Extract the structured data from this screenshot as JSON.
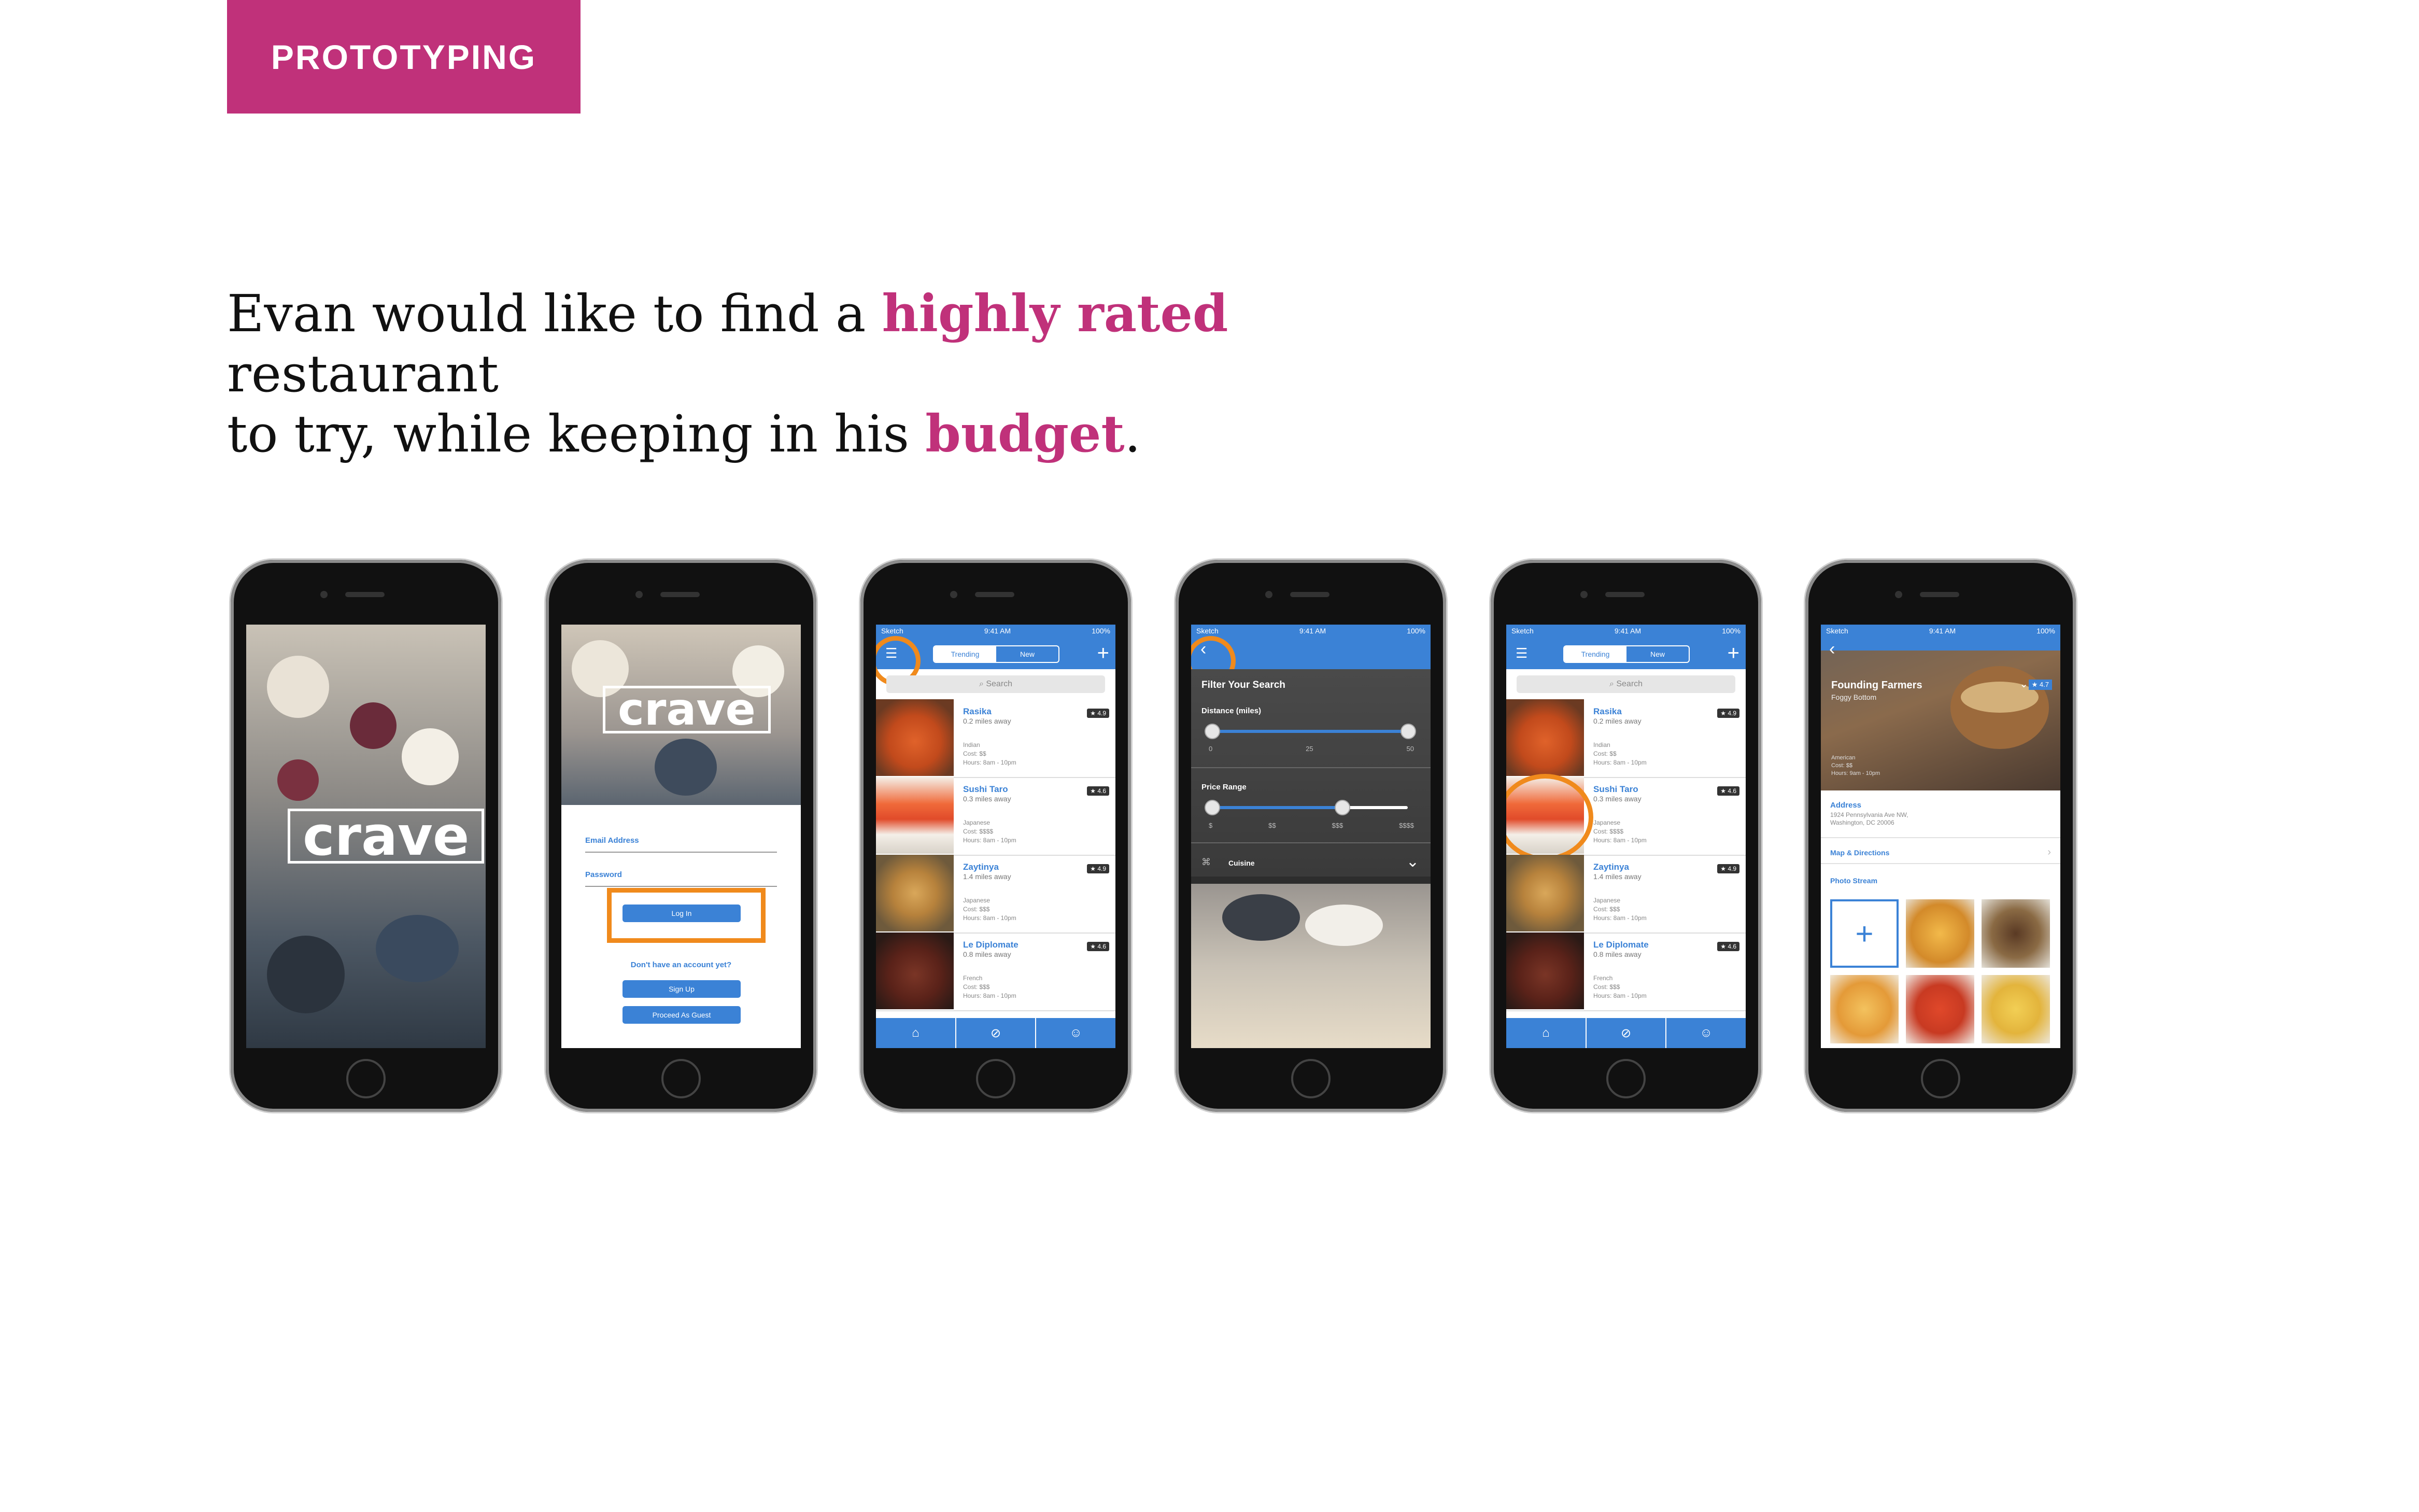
{
  "section_tag": "PROTOTYPING",
  "headline": {
    "part1": "Evan would like to find a ",
    "highlight1": "highly rated",
    "part2": " restaurant",
    "part3": "to try, while keeping in his ",
    "highlight2": "budget",
    "part4": "."
  },
  "colors": {
    "accent": "#c0317a",
    "app_blue": "#3b82d6",
    "highlight_ring": "#f08a1c"
  },
  "app": {
    "logo": "crave",
    "status": {
      "carrier": "Sketch",
      "time": "9:41 AM",
      "battery": "100%"
    },
    "login": {
      "email_label": "Email Address",
      "password_label": "Password",
      "login_button": "Log In",
      "no_account": "Don't have an account yet?",
      "signup_button": "Sign Up",
      "guest_button": "Proceed As Guest"
    },
    "tabs": {
      "trending": "Trending",
      "new": "New"
    },
    "search_placeholder": "Search",
    "restaurants": [
      {
        "name": "Rasika",
        "distance": "0.2 miles away",
        "meta": "Indian\nCost: $$\nHours: 8am - 10pm",
        "rating": "4.9"
      },
      {
        "name": "Sushi Taro",
        "distance": "0.3 miles away",
        "meta": "Japanese\nCost: $$$$\nHours: 8am - 10pm",
        "rating": "4.6"
      },
      {
        "name": "Zaytinya",
        "distance": "1.4 miles away",
        "meta": "Japanese\nCost: $$$\nHours: 8am - 10pm",
        "rating": "4.9"
      },
      {
        "name": "Le Diplomate",
        "distance": "0.8 miles away",
        "meta": "French\nCost: $$$\nHours: 8am - 10pm",
        "rating": "4.6"
      }
    ],
    "filter": {
      "title": "Filter Your Search",
      "distance_label": "Distance (miles)",
      "distance_ticks": [
        "0",
        "25",
        "50"
      ],
      "price_label": "Price Range",
      "price_ticks": [
        "$",
        "$$",
        "$$$",
        "$$$$"
      ],
      "cuisine_label": "Cuisine"
    },
    "detail": {
      "name": "Founding Farmers",
      "area": "Foggy Bottom",
      "rating": "4.7",
      "meta": "American\nCost: $$\nHours: 9am - 10pm",
      "address_label": "Address",
      "address": "1924 Pennsylvania Ave NW,\nWashington, DC 20006",
      "map_link": "Map & Directions",
      "photo_stream": "Photo Stream"
    }
  }
}
